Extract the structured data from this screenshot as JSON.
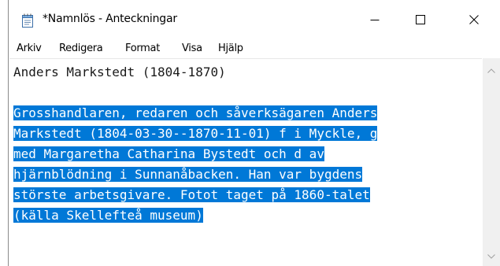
{
  "window": {
    "title": "*Namnlös - Anteckningar"
  },
  "menu": {
    "items": [
      "Arkiv",
      "Redigera",
      "Format",
      "Visa",
      "Hjälp"
    ]
  },
  "editor": {
    "lines": [
      "Anders Markstedt (1804-1870)",
      "",
      "Grosshandlaren, redaren och såverksägaren Anders",
      "Markstedt (1804-03-30--1870-11-01) f i Myckle, g",
      "med Margaretha Catharina Bystedt och d av",
      "hjärnblödning i Sunnanåbacken. Han var bygdens",
      "störste arbetsgivare. Fotot taget på 1860-talet",
      "(källa Skellefteå museum)"
    ],
    "selection_color": "#0078d7"
  },
  "icons": {
    "app": "notepad-icon",
    "minimize": "minimize-icon",
    "maximize": "maximize-icon",
    "close": "close-icon",
    "scroll_up": "chevron-up-icon",
    "scroll_down": "chevron-down-icon"
  }
}
